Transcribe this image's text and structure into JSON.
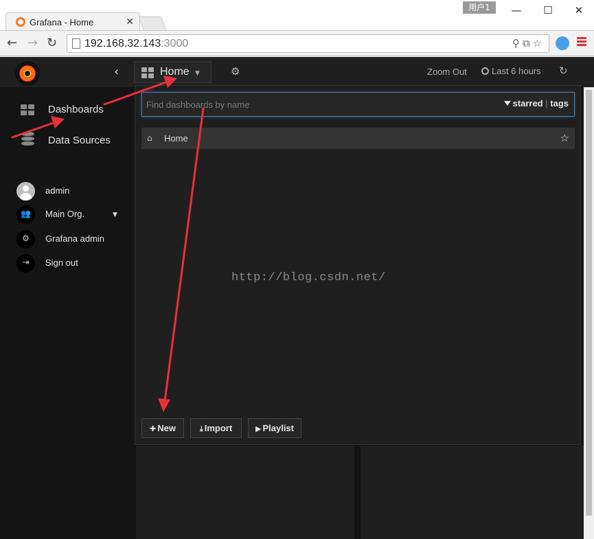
{
  "browser": {
    "user_badge": "用户1",
    "tab_title": "Grafana - Home",
    "url_host": "192.168.32.143",
    "url_port": ":3000",
    "window_controls": {
      "minimize": "—",
      "maximize": "☐",
      "close": "✕"
    },
    "nav": {
      "back": "←",
      "forward": "→",
      "reload": "↻"
    }
  },
  "topnav": {
    "collapse": "‹",
    "home_label": "Home",
    "zoom_out": "Zoom Out",
    "time_range": "Last 6 hours"
  },
  "sidemenu": {
    "items": [
      {
        "label": "Dashboards",
        "icon": "dashboards-grid-icon"
      },
      {
        "label": "Data Sources",
        "icon": "database-icon"
      }
    ],
    "user_items": [
      {
        "label": "admin",
        "icon": "user-avatar"
      },
      {
        "label": "Main Org.",
        "icon": "users-icon"
      },
      {
        "label": "Grafana admin",
        "icon": "gear-icon"
      },
      {
        "label": "Sign out",
        "icon": "sign-out-icon"
      }
    ]
  },
  "search": {
    "placeholder": "Find dashboards by name",
    "filter_starred": "starred",
    "filter_sep": "|",
    "filter_tags": "tags",
    "results": [
      {
        "label": "Home",
        "starred": false
      }
    ],
    "buttons": {
      "new": "New",
      "import": "Import",
      "playlist": "Playlist"
    }
  },
  "watermark": "http://blog.csdn.net/",
  "colors": {
    "annotation_arrow": "#e8303a",
    "sidebar_bg": "#141414",
    "panel_bg": "#1f1f1f",
    "focus_border": "#4a7fb3"
  }
}
